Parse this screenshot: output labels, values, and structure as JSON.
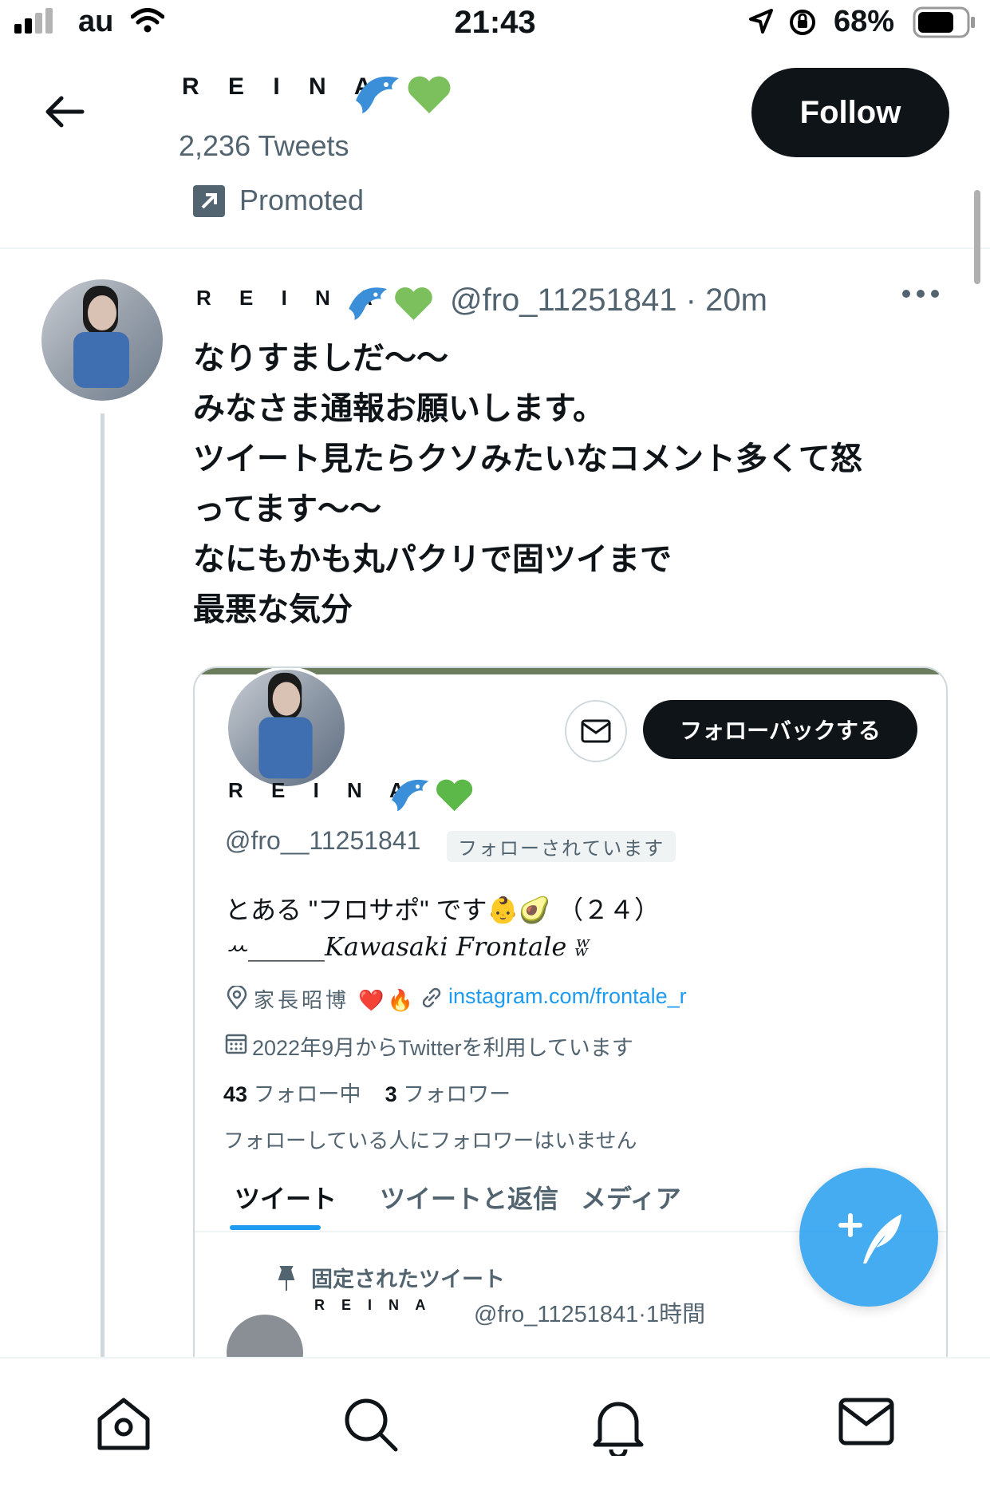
{
  "status_bar": {
    "carrier": "au",
    "time": "21:43",
    "battery": "68%"
  },
  "header": {
    "name": "R E I N A",
    "tweet_count": "2,236 Tweets",
    "promoted": "Promoted",
    "follow": "Follow"
  },
  "tweet": {
    "name": "R E I N A",
    "handle_time": "@fro_11251841 · 20m",
    "lines": [
      "なりすましだ〜〜",
      "みなさま通報お願いします。",
      "ツイート見たらクソみたいなコメント多くて怒",
      "ってます〜〜",
      "なにもかも丸パクリで固ツイまで",
      "最悪な気分"
    ]
  },
  "embedded": {
    "follow_back": "フォローバックする",
    "name": "R E I N A",
    "handle": "@fro__11251841",
    "follows_you": "フォローされています",
    "bio_line1": "とある \"フロサポ\" です👶🥑 （２４）",
    "bio_line2": "ꕀ______Kawasaki Frontale ʬ",
    "location": "家長昭博 ❤️🔥",
    "link": "instagram.com/frontale_r",
    "joined": "2022年9月からTwitterを利用しています",
    "following_count": "43",
    "following_label": "フォロー中",
    "followers_count": "3",
    "followers_label": "フォロワー",
    "no_mutuals": "フォローしている人にフォロワーはいません",
    "tabs": [
      "ツイート",
      "ツイートと返信",
      "メディア"
    ],
    "pinned": "固定されたツイート",
    "mini_name": "R E I N A",
    "mini_handle": "@fro_11251841·1時間"
  },
  "colors": {
    "accent": "#1d9bf0",
    "text": "#0f1419",
    "secondary": "#536471",
    "border": "#cfd9de"
  },
  "icons": {
    "back": "back-arrow-icon",
    "promoted": "promoted-icon",
    "more": "more-icon",
    "compose": "compose-icon",
    "home": "home-icon",
    "search": "search-icon",
    "notifications": "bell-icon",
    "messages": "mail-icon"
  }
}
